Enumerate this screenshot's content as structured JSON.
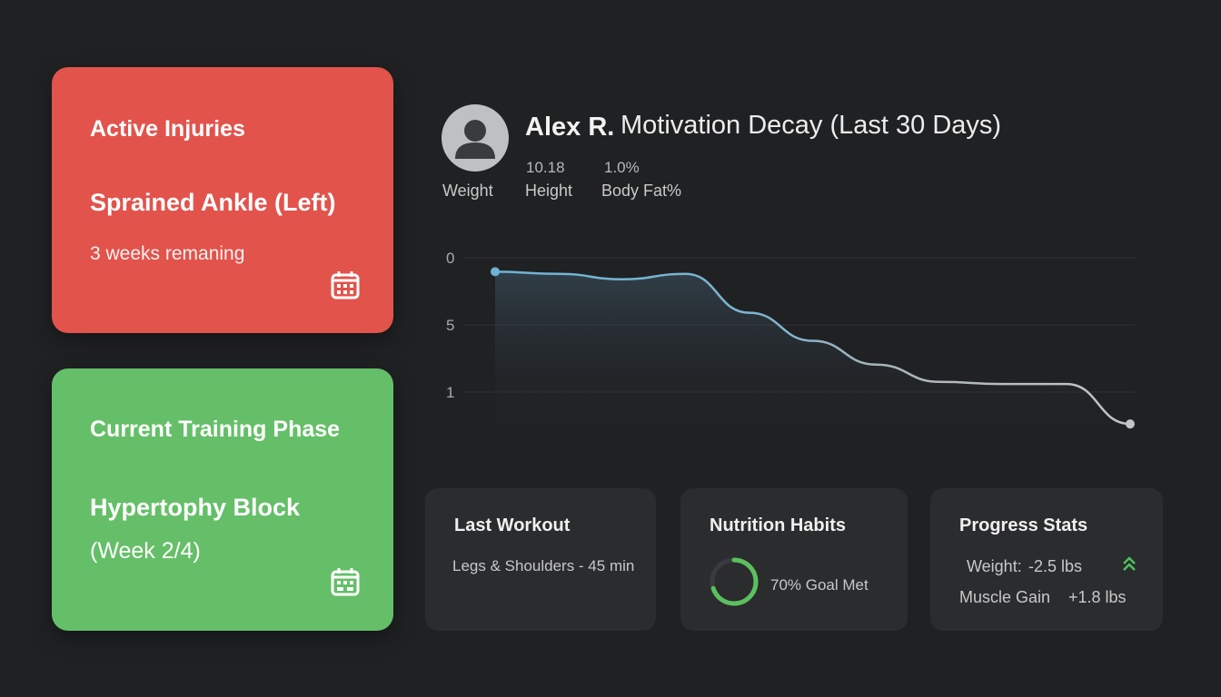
{
  "injuries": {
    "title": "Active Injuries",
    "injury": "Sprained Ankle (Left)",
    "remaining": "3 weeks remaning",
    "icon": "calendar-icon",
    "color": "#e2534c"
  },
  "training_phase": {
    "title": "Current Training Phase",
    "block": "Hypertophy Block",
    "week": "(Week 2/4)",
    "icon": "calendar-icon",
    "color": "#65bf68"
  },
  "profile": {
    "name": "Alex R.",
    "avatar_icon": "user-avatar-icon",
    "stats": [
      {
        "value": "",
        "label": "Weight"
      },
      {
        "value": "10.18",
        "label": "Height"
      },
      {
        "value": "1.0%",
        "label": "Body Fat%"
      }
    ]
  },
  "chart_data": {
    "type": "line",
    "title": "Motivation Decay (Last 30 Days)",
    "xlabel": "",
    "ylabel": "",
    "y_tick_labels": [
      "0",
      "5",
      "1"
    ],
    "grid": true,
    "x": [
      0,
      1,
      2,
      3,
      4,
      5,
      6,
      7,
      8,
      9,
      10
    ],
    "values": [
      0.2,
      0.4,
      0.9,
      0.4,
      4.0,
      6.6,
      8.8,
      10.4,
      10.6,
      10.6,
      14.3
    ]
  },
  "last_workout": {
    "title": "Last Workout",
    "text": "Legs & Shoulders - 45 min"
  },
  "nutrition": {
    "title": "Nutrition Habits",
    "label": "70% Goal Met",
    "progress": 0.7,
    "ring_color": "#5cc05f"
  },
  "progress_stats": {
    "title": "Progress Stats",
    "weight_label": "Weight:",
    "weight_value": "-2.5 lbs",
    "muscle_label": "Muscle Gain",
    "muscle_value": "+1.8 lbs",
    "trend_icon": "double-chevron-up-icon",
    "trend_color": "#4cc35a"
  }
}
